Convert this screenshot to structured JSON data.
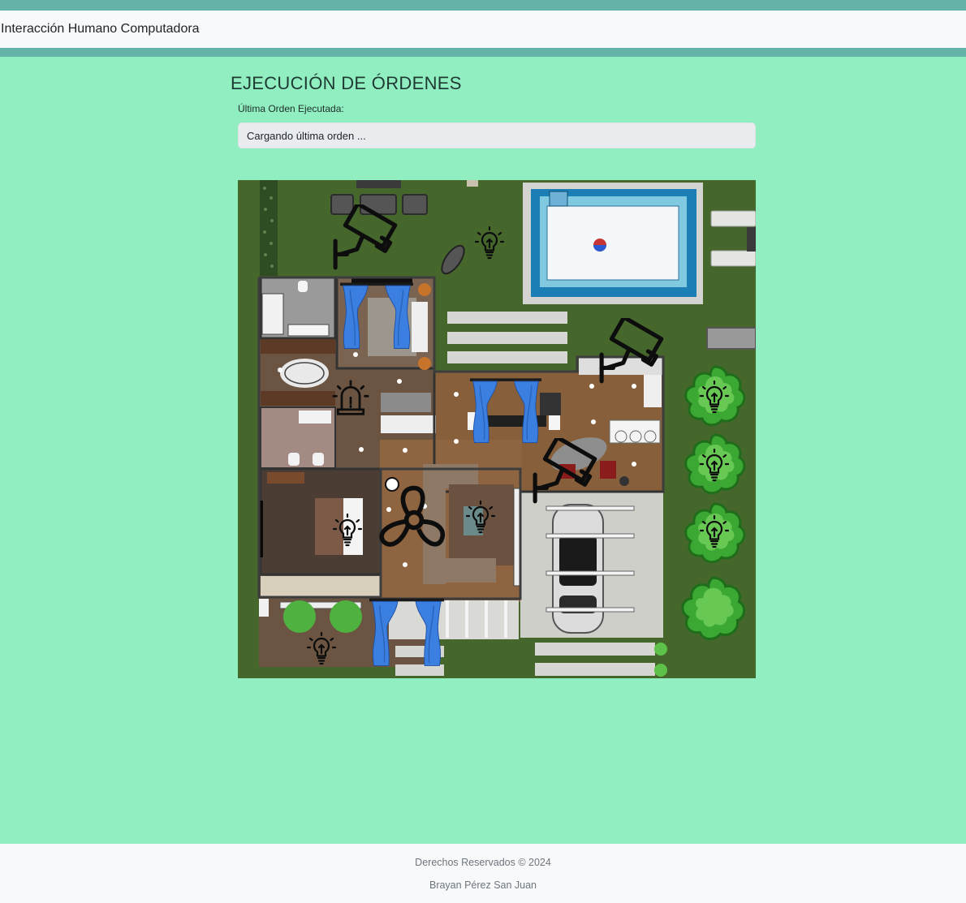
{
  "navbar": {
    "brand": "Interacción Humano Computadora"
  },
  "main": {
    "title": "EJECUCIÓN DE ÓRDENES",
    "last_order_label": "Última Orden Ejecutada:",
    "last_order_value": "Cargando última orden ..."
  },
  "plan": {
    "controls": [
      {
        "id": "camera-garden",
        "icon": "security-camera-icon"
      },
      {
        "id": "camera-patio",
        "icon": "security-camera-icon"
      },
      {
        "id": "camera-living",
        "icon": "security-camera-icon"
      },
      {
        "id": "light-garden",
        "icon": "lightbulb-icon"
      },
      {
        "id": "light-tree-1",
        "icon": "lightbulb-icon"
      },
      {
        "id": "light-tree-2",
        "icon": "lightbulb-icon"
      },
      {
        "id": "light-tree-3",
        "icon": "lightbulb-icon"
      },
      {
        "id": "light-bedroom",
        "icon": "lightbulb-icon"
      },
      {
        "id": "light-living",
        "icon": "lightbulb-icon"
      },
      {
        "id": "light-entrance",
        "icon": "lightbulb-icon"
      },
      {
        "id": "alarm",
        "icon": "alarm-siren-icon"
      },
      {
        "id": "fan",
        "icon": "fan-icon"
      },
      {
        "id": "curtain-bedroom",
        "icon": "curtain-icon"
      },
      {
        "id": "curtain-dining",
        "icon": "curtain-icon"
      },
      {
        "id": "curtain-entrance",
        "icon": "curtain-icon"
      }
    ]
  },
  "footer": {
    "rights": "Derechos Reservados © 2024",
    "author": "Brayan Pérez San Juan"
  }
}
